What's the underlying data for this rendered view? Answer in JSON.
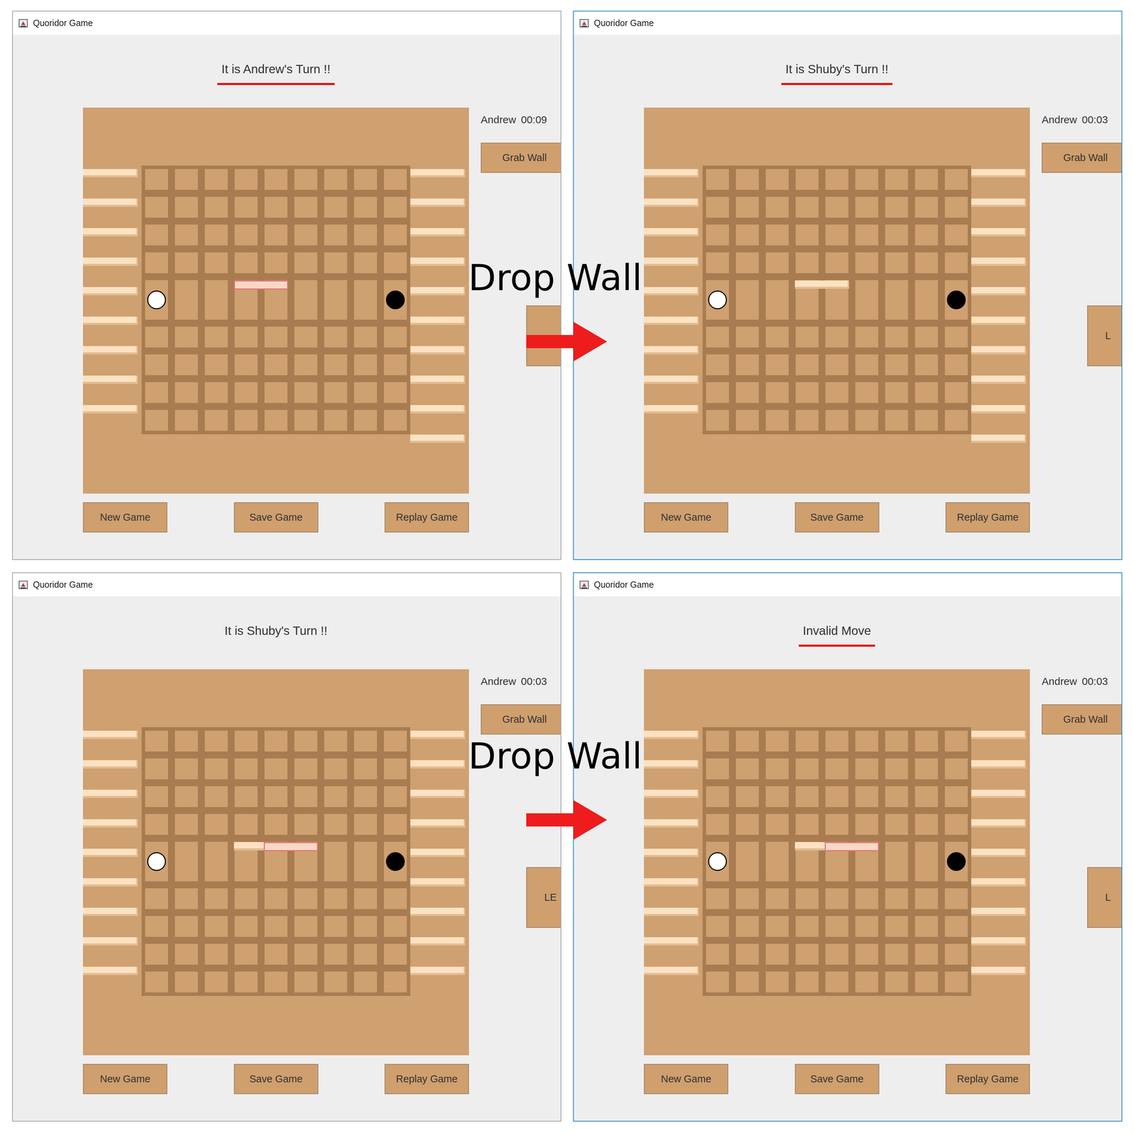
{
  "annotations": [
    {
      "label": "Drop Wall"
    },
    {
      "label": "Drop Wall"
    }
  ],
  "screens": [
    {
      "window": {
        "title": "Quoridor Game",
        "focused": false
      },
      "status": {
        "text": "It is Andrew's Turn !!",
        "highlighted": true
      },
      "player": {
        "name": "Andrew",
        "time": "00:09"
      },
      "grab_button": "Grab Wall",
      "side_button": {
        "label": ""
      },
      "left_walls": 9,
      "right_walls": 10,
      "pawns": [
        {
          "color": "#ffffff",
          "row": 4,
          "col": 0
        },
        {
          "color": "#000000",
          "row": 4,
          "col": 8
        }
      ],
      "board_walls": [
        {
          "row": 4,
          "col": 3,
          "held": true
        }
      ],
      "buttons": [
        "New Game",
        "Save Game",
        "Replay Game"
      ]
    },
    {
      "window": {
        "title": "Quoridor Game",
        "focused": true
      },
      "status": {
        "text": "It is Shuby's Turn !!",
        "highlighted": true
      },
      "player": {
        "name": "Andrew",
        "time": "00:03"
      },
      "grab_button": "Grab Wall",
      "side_button": {
        "label": "L"
      },
      "left_walls": 9,
      "right_walls": 10,
      "pawns": [
        {
          "color": "#ffffff",
          "row": 4,
          "col": 0
        },
        {
          "color": "#000000",
          "row": 4,
          "col": 8
        }
      ],
      "board_walls": [
        {
          "row": 4,
          "col": 3,
          "held": false
        }
      ],
      "buttons": [
        "New Game",
        "Save Game",
        "Replay Game"
      ]
    },
    {
      "window": {
        "title": "Quoridor Game",
        "focused": false
      },
      "status": {
        "text": "It is Shuby's Turn !!",
        "highlighted": false
      },
      "player": {
        "name": "Andrew",
        "time": "00:03"
      },
      "grab_button": "Grab Wall",
      "side_button": {
        "label": "LE"
      },
      "left_walls": 9,
      "right_walls": 9,
      "pawns": [
        {
          "color": "#ffffff",
          "row": 4,
          "col": 0
        },
        {
          "color": "#000000",
          "row": 4,
          "col": 8
        }
      ],
      "board_walls": [
        {
          "row": 4,
          "col": 3,
          "held": false
        },
        {
          "row": 4,
          "col": 4,
          "held": true
        }
      ],
      "buttons": [
        "New Game",
        "Save Game",
        "Replay Game"
      ]
    },
    {
      "window": {
        "title": "Quoridor Game",
        "focused": true
      },
      "status": {
        "text": "Invalid Move",
        "highlighted": true
      },
      "player": {
        "name": "Andrew",
        "time": "00:03"
      },
      "grab_button": "Grab Wall",
      "side_button": {
        "label": "L"
      },
      "left_walls": 9,
      "right_walls": 9,
      "pawns": [
        {
          "color": "#ffffff",
          "row": 4,
          "col": 0
        },
        {
          "color": "#000000",
          "row": 4,
          "col": 8
        }
      ],
      "board_walls": [
        {
          "row": 4,
          "col": 3,
          "held": false
        },
        {
          "row": 4,
          "col": 4,
          "held": true
        }
      ],
      "buttons": [
        "New Game",
        "Save Game",
        "Replay Game"
      ]
    }
  ]
}
